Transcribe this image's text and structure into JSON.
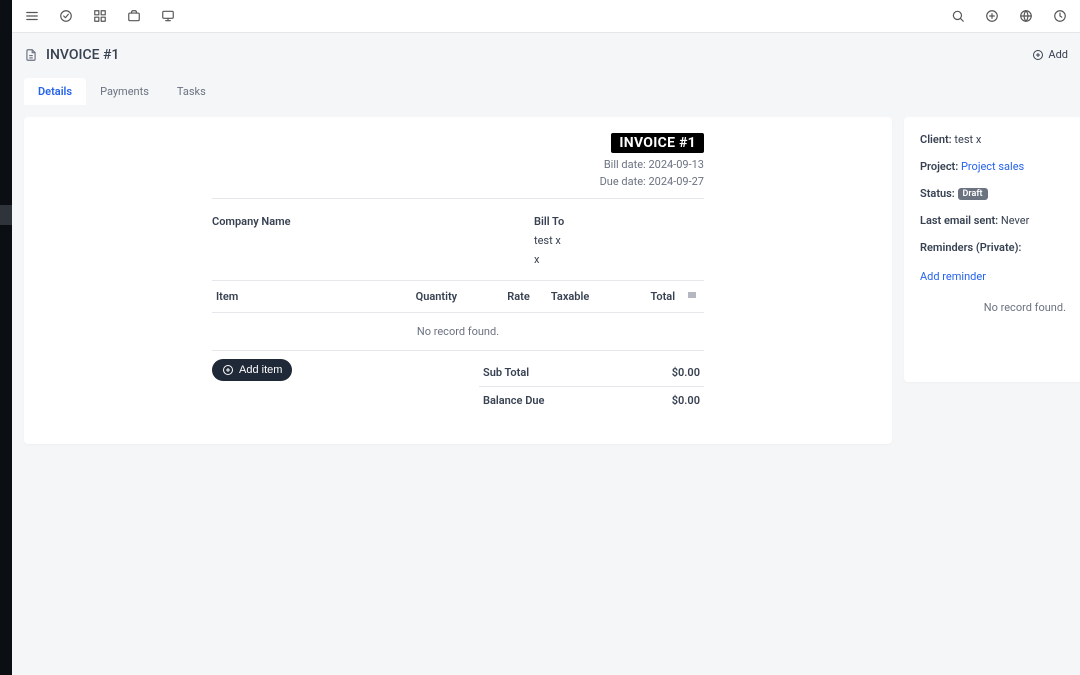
{
  "topbar": {
    "left_icons": [
      "menu-icon",
      "check-circle-icon",
      "grid-icon",
      "briefcase-icon",
      "monitor-icon"
    ],
    "right_icons": [
      "search-icon",
      "plus-circle-icon",
      "globe-icon",
      "clock-icon"
    ]
  },
  "page": {
    "title": "INVOICE #1",
    "add_label": "Add"
  },
  "tabs": [
    {
      "id": "details",
      "label": "Details",
      "active": true
    },
    {
      "id": "payments",
      "label": "Payments",
      "active": false
    },
    {
      "id": "tasks",
      "label": "Tasks",
      "active": false
    }
  ],
  "invoice": {
    "badge": "INVOICE #1",
    "bill_date_label": "Bill date:",
    "bill_date": "2024-09-13",
    "due_date_label": "Due date:",
    "due_date": "2024-09-27",
    "company_label": "Company Name",
    "bill_to_label": "Bill To",
    "bill_to_name": "test x",
    "bill_to_address": "x",
    "columns": {
      "item": "Item",
      "quantity": "Quantity",
      "rate": "Rate",
      "taxable": "Taxable",
      "total": "Total"
    },
    "no_record": "No record found.",
    "add_item_label": "Add item",
    "totals": {
      "subtotal_label": "Sub Total",
      "subtotal_value": "$0.00",
      "balance_label": "Balance Due",
      "balance_value": "$0.00"
    }
  },
  "side": {
    "client_label": "Client:",
    "client_value": "test x",
    "project_label": "Project:",
    "project_value": "Project sales",
    "status_label": "Status:",
    "status_value": "Draft",
    "lastemail_label": "Last email sent:",
    "lastemail_value": "Never",
    "reminders_label": "Reminders (Private):",
    "add_reminder": "Add reminder",
    "no_record": "No record found."
  }
}
